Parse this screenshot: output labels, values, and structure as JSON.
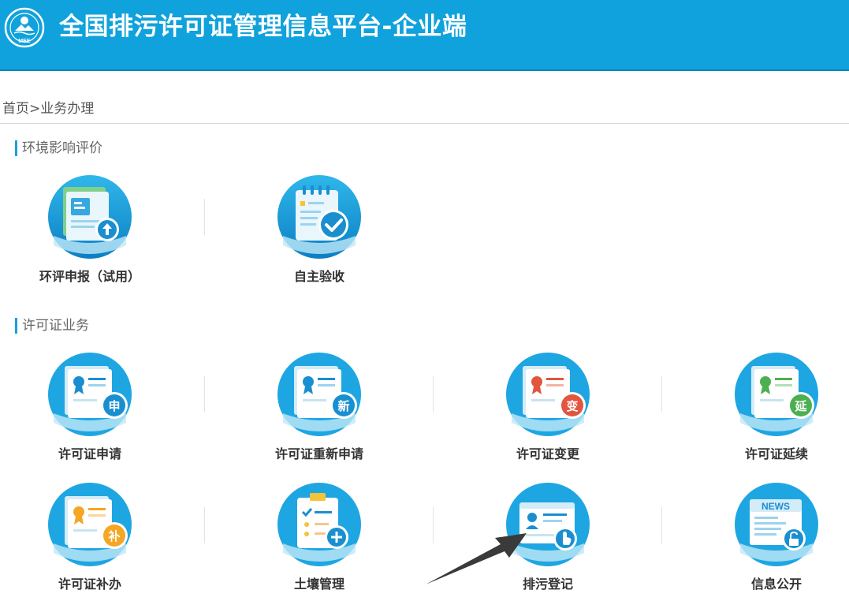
{
  "header": {
    "title": "全国排污许可证管理信息平台-企业端",
    "logo_text": "MEE",
    "bg_color": "#10a2dc"
  },
  "breadcrumb": {
    "home": "首页",
    "separator": ">",
    "current": "业务办理"
  },
  "sections": [
    {
      "title": "环境影响评价",
      "items": [
        {
          "label": "环评申报（试用）",
          "icon": "upload-document-icon"
        },
        {
          "label": "自主验收",
          "icon": "calendar-check-icon"
        }
      ]
    },
    {
      "title": "许可证业务",
      "items": [
        {
          "label": "许可证申请",
          "icon": "certificate-apply-icon",
          "badge": "申",
          "badge_color": "#1a8fd0"
        },
        {
          "label": "许可证重新申请",
          "icon": "certificate-reapply-icon",
          "badge": "新",
          "badge_color": "#1a8fd0"
        },
        {
          "label": "许可证变更",
          "icon": "certificate-change-icon",
          "badge": "变",
          "badge_color": "#e2553f"
        },
        {
          "label": "许可证延续",
          "icon": "certificate-extend-icon",
          "badge": "延",
          "badge_color": "#4caf50"
        },
        {
          "label": "许可证补办",
          "icon": "certificate-reissue-icon",
          "badge": "补",
          "badge_color": "#f5a623"
        },
        {
          "label": "土壤管理",
          "icon": "soil-management-icon"
        },
        {
          "label": "排污登记",
          "icon": "discharge-registration-icon"
        },
        {
          "label": "信息公开",
          "icon": "news-disclosure-icon",
          "news_text": "NEWS"
        }
      ]
    }
  ]
}
